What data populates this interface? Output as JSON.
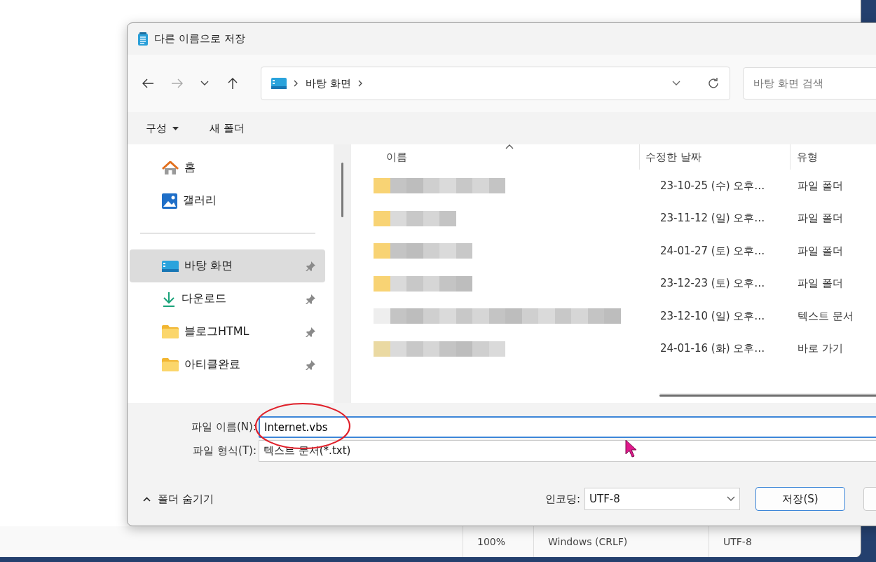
{
  "dialog": {
    "title": "다른 이름으로 저장"
  },
  "navigation": {
    "breadcrumb": [
      "바탕 화면"
    ],
    "search": {
      "placeholder": "바탕 화면 검색"
    }
  },
  "commands": [
    {
      "label": "구성",
      "dropdown": true
    },
    {
      "label": "새 폴더",
      "dropdown": false
    }
  ],
  "sidebar": {
    "items": [
      {
        "kind": "home",
        "label": "홈",
        "pinned": false,
        "selected": false
      },
      {
        "kind": "gallery",
        "label": "갤러리",
        "pinned": false,
        "selected": false
      },
      {
        "kind": "desktop",
        "label": "바탕 화면",
        "pinned": true,
        "selected": true
      },
      {
        "kind": "download",
        "label": "다운로드",
        "pinned": true,
        "selected": false
      },
      {
        "kind": "folder",
        "label": "블로그HTML",
        "pinned": true,
        "selected": false
      },
      {
        "kind": "folder",
        "label": "아티클완료",
        "pinned": true,
        "selected": false
      }
    ]
  },
  "file_list": {
    "columns": [
      {
        "label": "이름",
        "sorted": true
      },
      {
        "label": "수정한 날짜",
        "sorted": false
      },
      {
        "label": "유형",
        "sorted": false
      }
    ],
    "rows": [
      {
        "kind": "folder",
        "modified": "23-10-25 (수) 오후…",
        "type": "파일 폴더"
      },
      {
        "kind": "folder",
        "modified": "23-11-12 (일) 오후…",
        "type": "파일 폴더"
      },
      {
        "kind": "folder",
        "modified": "24-01-27 (토) 오후…",
        "type": "파일 폴더"
      },
      {
        "kind": "folder",
        "modified": "23-12-23 (토) 오후…",
        "type": "파일 폴더"
      },
      {
        "kind": "text",
        "modified": "23-12-10 (일) 오후…",
        "type": "텍스트 문서"
      },
      {
        "kind": "shortcut",
        "modified": "24-01-16 (화) 오후…",
        "type": "바로 가기"
      }
    ]
  },
  "form": {
    "file_name": {
      "label": "파일 이름(N):",
      "value": "Internet.vbs"
    },
    "file_type": {
      "label": "파일 형식(T):",
      "value": "텍스트 문서(*.txt)"
    }
  },
  "footer": {
    "hide_folders": "폴더 숨기기",
    "encoding": {
      "label": "인코딩:",
      "value": "UTF-8"
    },
    "save_button": "저장(S)"
  },
  "status_bar": [
    "100%",
    "Windows (CRLF)",
    "UTF-8"
  ]
}
